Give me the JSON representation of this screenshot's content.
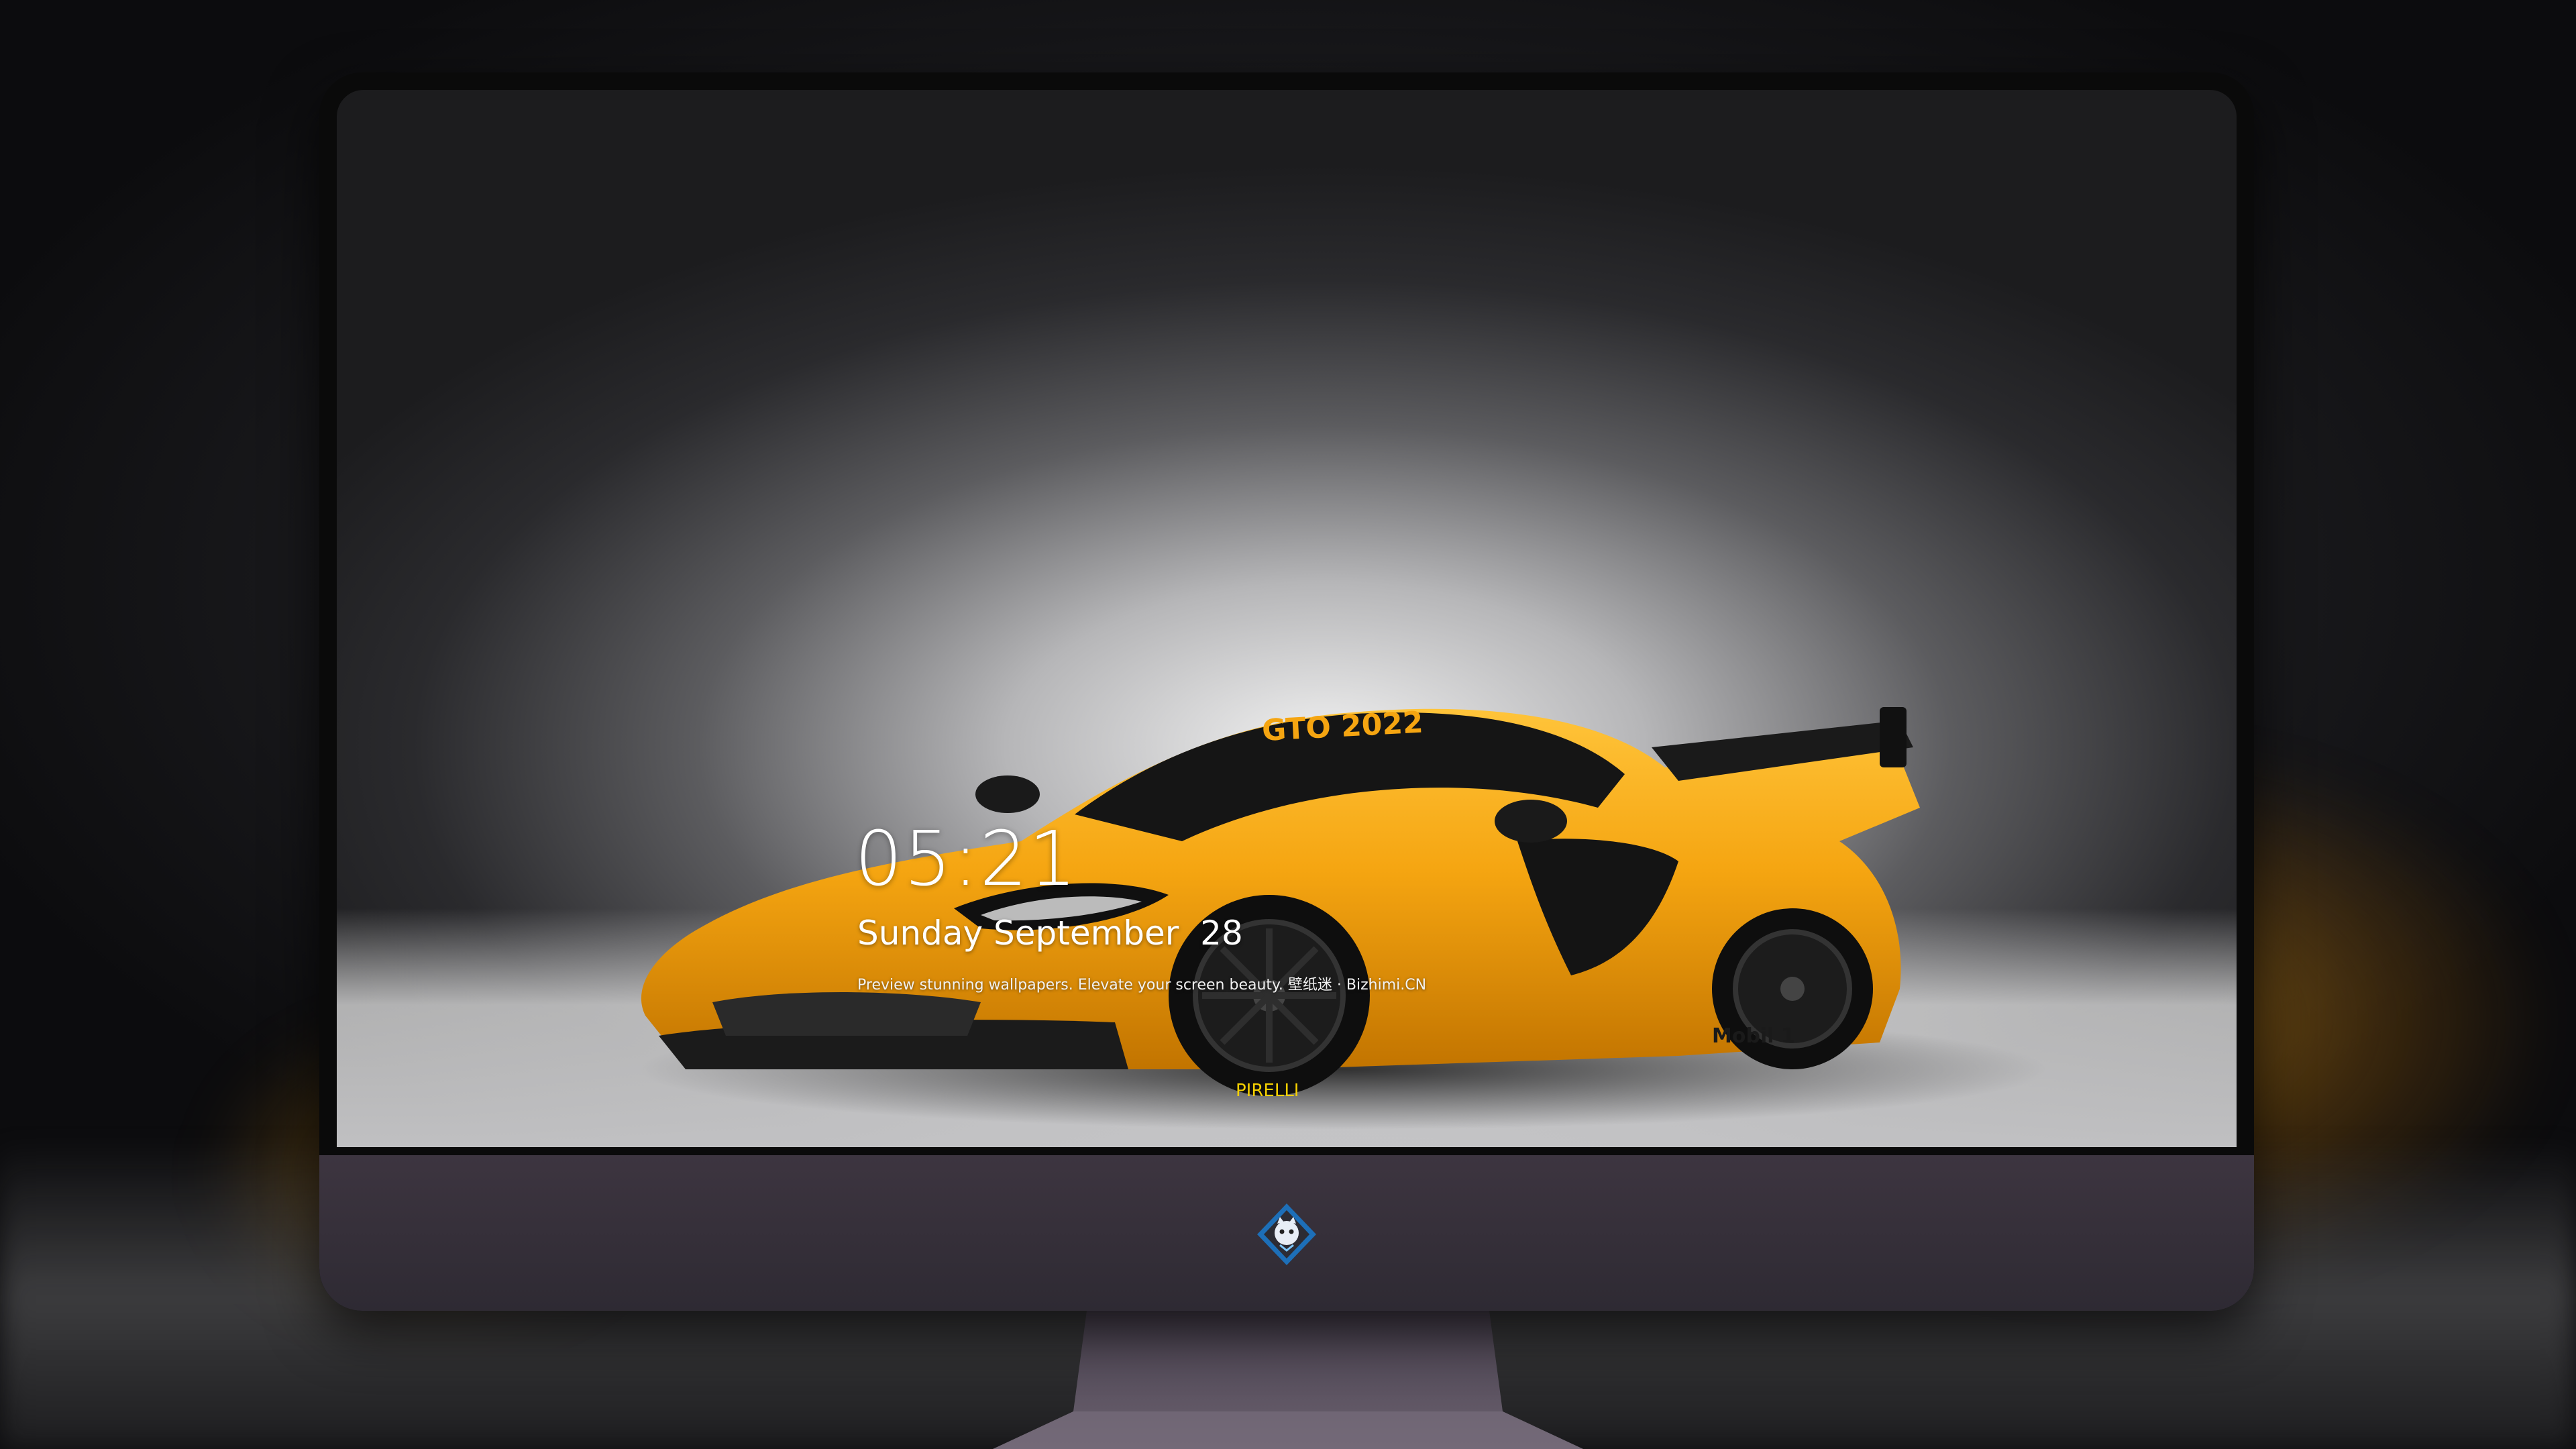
{
  "lockscreen": {
    "time": "05:21",
    "date": "Sunday September  28",
    "tagline": "Preview stunning wallpapers. Elevate your screen beauty. 壁纸迷 · Bizhimi.CN"
  },
  "car": {
    "windshield_text": "GTO 2022",
    "side_text": "Mobil 1",
    "tyre_text": "PIRELLI",
    "body_color": "#f5a511"
  },
  "dock": {
    "apps": [
      {
        "icon": "messages-icon",
        "color": "#34c759"
      },
      {
        "icon": "weather-icon",
        "color": "#2f8cf0"
      },
      {
        "icon": "clock-icon",
        "color": "#111111"
      },
      {
        "icon": "preview-icon",
        "color": "#f2c14e"
      },
      {
        "icon": "clips-icon",
        "color": "#3ab8d9"
      },
      {
        "icon": "notes-icon",
        "color": "#ffd84d"
      },
      {
        "icon": "photo-booth-icon",
        "color": "#e85d3c"
      }
    ],
    "pinned": [
      {
        "icon": "music-icon",
        "color": "#fa57c1"
      },
      {
        "icon": "app-store-icon",
        "color": "#1e88f7"
      },
      {
        "icon": "camera-icon",
        "color": "#9a9a9a"
      }
    ]
  },
  "colors": {
    "accent": "#f5a511",
    "chin": "#3a3240"
  }
}
